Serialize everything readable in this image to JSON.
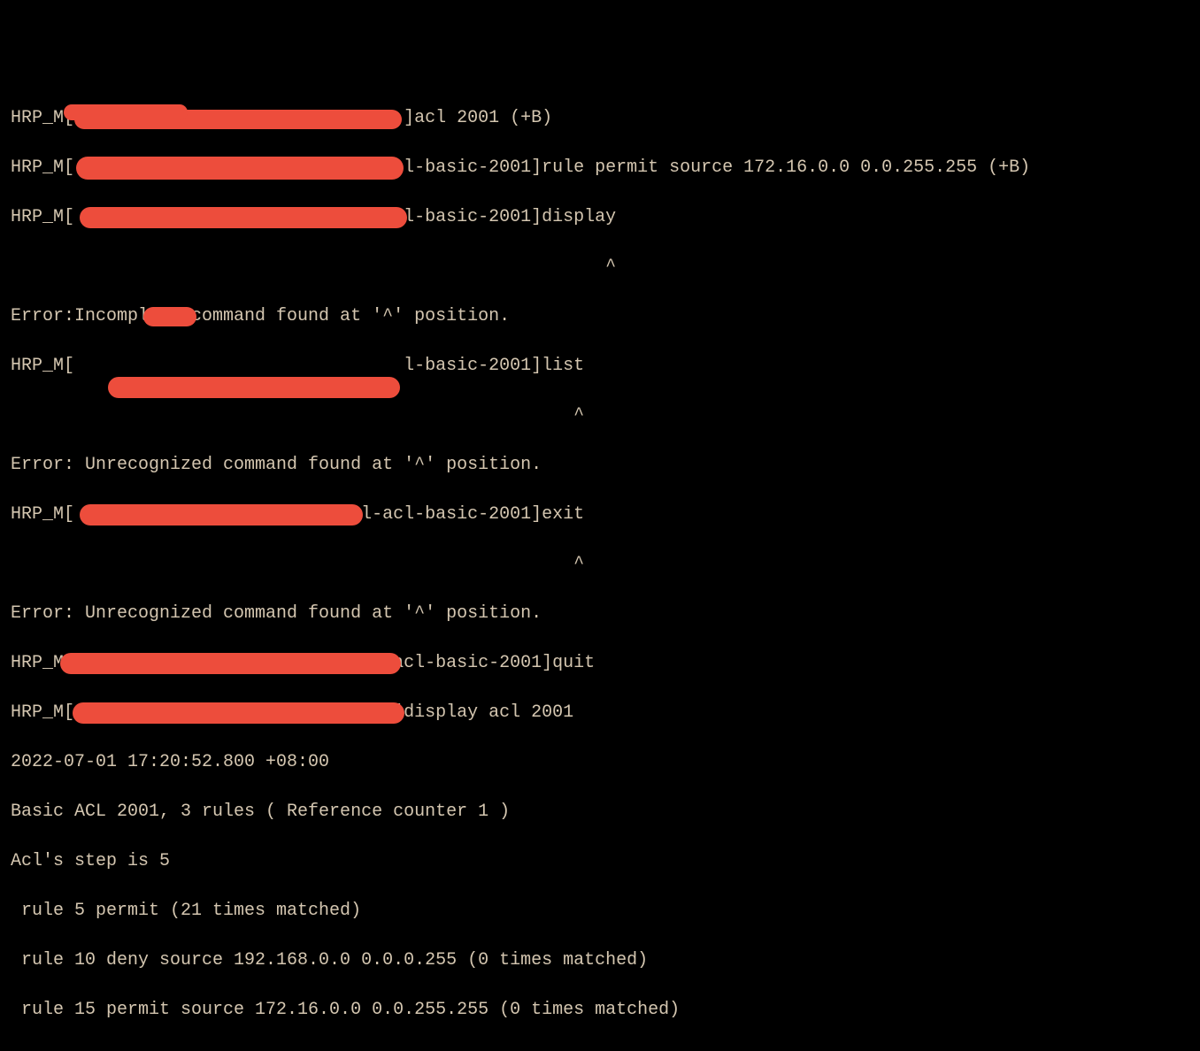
{
  "lines": {
    "l1": "HRP_M[                               ]acl 2001 (+B)",
    "l2": "HRP_M[                               l-basic-2001]rule permit source 172.16.0.0 0.0.255.255 (+B)",
    "l3": "HRP_M[                               l-basic-2001]display",
    "l4": "                                                        ^",
    "l5": "Error:Incomplete command found at '^' position.",
    "l6": "HRP_M[                               l-basic-2001]list",
    "l7": "                                                     ^",
    "l8": "Error: Unrecognized command found at '^' position.",
    "l9": "HRP_M[                           l-acl-basic-2001]exit",
    "l10": "                                                     ^",
    "l11": "Error: Unrecognized command found at '^' position.",
    "l12": "HRP_M[                             -acl-basic-2001]quit",
    "l13": "HRP_M[                              ]display acl 2001",
    "l14": "2022-07-01 17:20:52.800 +08:00",
    "l15": "Basic ACL 2001, 3 rules ( Reference counter 1 )",
    "l16": "Acl's step is 5",
    "l17": " rule 5 permit (21 times matched)",
    "l18": " rule 10 deny source 192.168.0.0 0.0.0.255 (0 times matched)",
    "l19": " rule 15 permit source 172.16.0.0 0.0.255.255 (0 times matched)"
  }
}
